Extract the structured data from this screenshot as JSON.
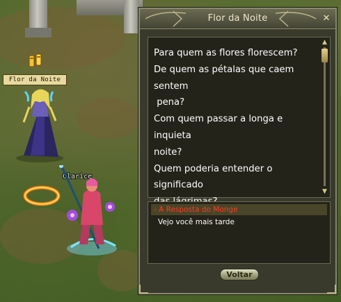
{
  "npc": {
    "name_plate": "Flor da Noite",
    "icon": "quest-scroll-icon"
  },
  "player": {
    "name": "Clarice"
  },
  "dialog": {
    "title": "Flor da Noite",
    "close_icon": "close-icon",
    "story_lines": [
      "Para quem as flores florescem?",
      "De quem as pétalas que caem sentem",
      " pena?",
      "Com quem passar a longa e inquieta",
      "noite?",
      "Quem poderia entender o significado",
      "das lágrimas?"
    ],
    "options": [
      {
        "label": "- A Resposta do Monge",
        "color": "#ff3a1e"
      },
      {
        "label": "Vejo você mais tarde",
        "color": "#ffffff"
      }
    ],
    "button_label": "Voltar",
    "colors": {
      "panel": "#3a3a2c",
      "text_box": "#23231a",
      "title_text": "#f0e6c8",
      "highlight_row": "#494528"
    }
  }
}
